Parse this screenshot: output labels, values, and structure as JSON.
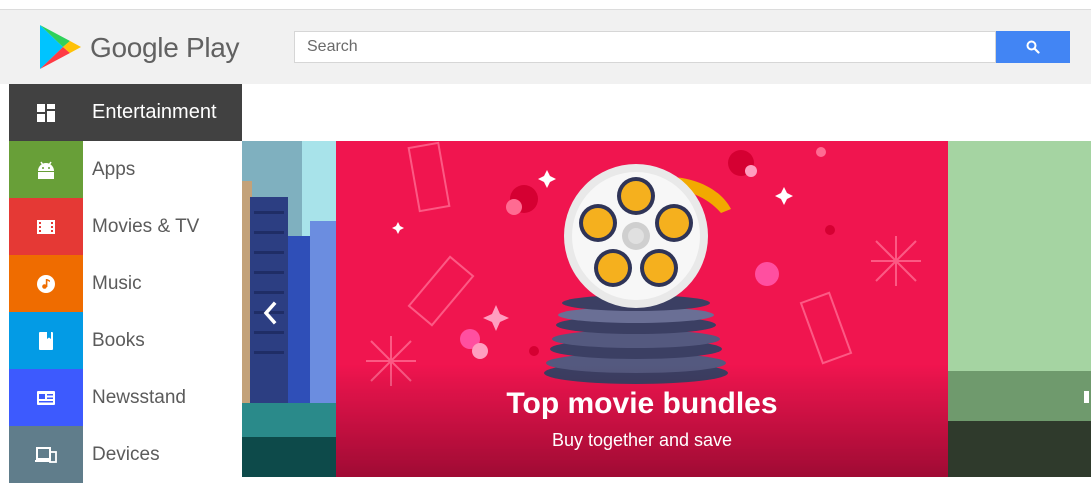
{
  "app": {
    "brand_name": "Google Play"
  },
  "search": {
    "placeholder": "Search",
    "button_icon": "search-icon"
  },
  "nav": {
    "items": [
      {
        "label": "Entertainment",
        "icon": "grid-icon",
        "color": "#414141",
        "active": true
      },
      {
        "label": "Apps",
        "icon": "android-icon",
        "color": "#689f38"
      },
      {
        "label": "Movies & TV",
        "icon": "film-icon",
        "color": "#e53935"
      },
      {
        "label": "Music",
        "icon": "music-note-icon",
        "color": "#ef6c00"
      },
      {
        "label": "Books",
        "icon": "book-icon",
        "color": "#039be5"
      },
      {
        "label": "Newsstand",
        "icon": "newspaper-icon",
        "color": "#3d5afe"
      },
      {
        "label": "Devices",
        "icon": "devices-icon",
        "color": "#607d8b"
      }
    ]
  },
  "banner": {
    "title": "Top movie bundles",
    "subtitle": "Buy together and save",
    "background_color": "#f0154f",
    "prev_icon": "chevron-left-icon"
  },
  "colors": {
    "search_button": "#4285f4",
    "accent_right_panel": "#a5d4a2"
  }
}
